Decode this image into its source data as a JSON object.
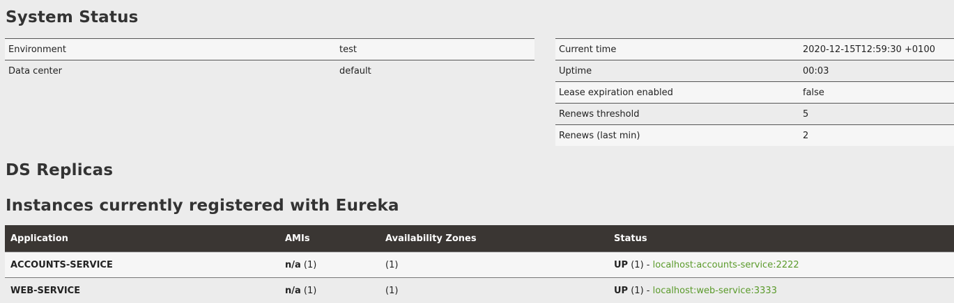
{
  "titles": {
    "system_status": "System Status",
    "ds_replicas": "DS Replicas",
    "instances": "Instances currently registered with Eureka"
  },
  "general_info": [
    {
      "key": "Environment",
      "value": "test"
    },
    {
      "key": "Data center",
      "value": "default"
    }
  ],
  "runtime_info": [
    {
      "key": "Current time",
      "value": "2020-12-15T12:59:30 +0100"
    },
    {
      "key": "Uptime",
      "value": "00:03"
    },
    {
      "key": "Lease expiration enabled",
      "value": "false"
    },
    {
      "key": "Renews threshold",
      "value": "5"
    },
    {
      "key": "Renews (last min)",
      "value": "2"
    }
  ],
  "instances_table": {
    "headers": [
      "Application",
      "AMIs",
      "Availability Zones",
      "Status"
    ],
    "rows": [
      {
        "application": "ACCOUNTS-SERVICE",
        "amis_label": "n/a",
        "amis_count": "(1)",
        "zones": "(1)",
        "status_label": "UP",
        "status_count": "(1)",
        "separator": "-",
        "link": "localhost:accounts-service:2222"
      },
      {
        "application": "WEB-SERVICE",
        "amis_label": "n/a",
        "amis_count": "(1)",
        "zones": "(1)",
        "status_label": "UP",
        "status_count": "(1)",
        "separator": "-",
        "link": "localhost:web-service:3333"
      }
    ]
  },
  "colors": {
    "header_bg": "#3a3633",
    "link": "#5a9a2a",
    "page_bg": "#ececec"
  }
}
